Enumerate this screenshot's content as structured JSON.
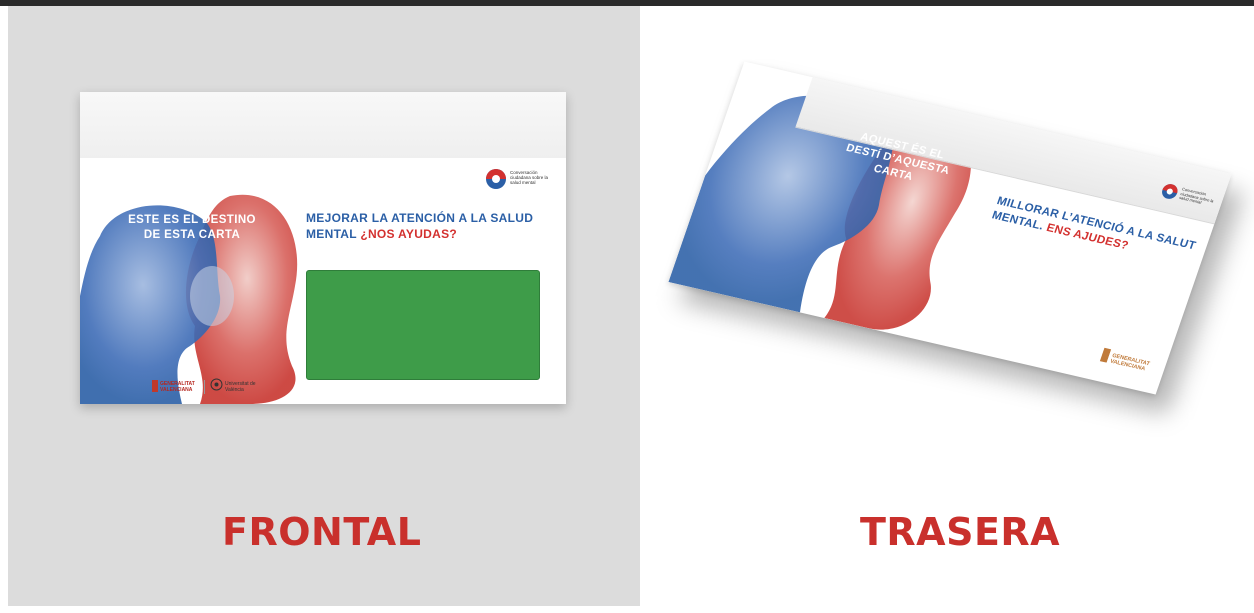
{
  "front": {
    "caption": "FRONTAL",
    "headline": "ESTE ES EL DESTINO DE ESTA CARTA",
    "slogan_part1": "MEJORAR LA ATENCIÓN A LA SALUD MENTAL",
    "slogan_part2": "¿NOS AYUDAS?",
    "brand_text": "Conversación ciudadana sobre la salud mental",
    "logo_gv": "GENERALITAT VALENCIANA",
    "logo_uv": "Universitat de València",
    "window_color": "#3e9c49"
  },
  "back": {
    "caption": "TRASERA",
    "headline": "AQUEST ÉS EL DESTÍ D’AQUESTA CARTA",
    "slogan_part1": "MILLORAR L’ATENCIÓ A LA SALUT MENTAL.",
    "slogan_part2": "ENS AJUDES?",
    "brand_text": "Conversación ciudadana sobre la salud mental",
    "logo_gv": "GENERALITAT VALENCIANA"
  },
  "colors": {
    "accent_red": "#c9302c",
    "accent_blue": "#2b5fa6",
    "left_bg": "#dcdcdc"
  }
}
